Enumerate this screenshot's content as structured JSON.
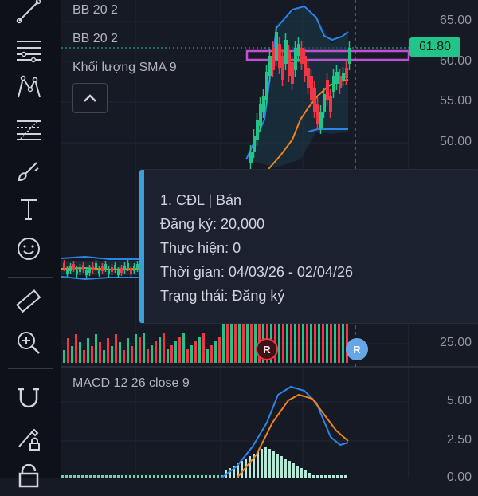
{
  "legend": {
    "bb1": "BB 20 2",
    "bb2": "BB 20 2",
    "volume": "Khối lượng SMA 9",
    "macd": "MACD 12 26 close 9"
  },
  "price_axis": [
    "65.00",
    "60.00",
    "55.00",
    "50.00",
    "25.00"
  ],
  "current_price": "61.80",
  "macd_axis": [
    "5.00",
    "2.50",
    "0.00"
  ],
  "tooltip": {
    "line1": "1. CĐL | Bán",
    "line2": "Đăng ký: 20,000",
    "line3": "Thực hiện: 0",
    "line4": "Thời gian: 04/03/26 - 02/04/26",
    "line5": "Trạng thái: Đăng ký"
  },
  "markers": {
    "sell": "R",
    "buy": "R"
  },
  "tools": [
    "trend-line-icon",
    "horizontal-lines-icon",
    "pattern-icon",
    "fib-icon",
    "brush-icon",
    "text-icon",
    "emoji-icon",
    "ruler-icon",
    "zoom-in-icon",
    "magnet-icon",
    "lock-drawing-icon",
    "lock-icon"
  ],
  "colors": {
    "up": "#22c48a",
    "down": "#f23645",
    "bb": "#2b85e8",
    "sma": "#f0821e",
    "macd": "#2b85e8",
    "signal": "#f0821e",
    "highlight": "#c24fd6",
    "tooltip_accent": "#3aa0d8"
  }
}
